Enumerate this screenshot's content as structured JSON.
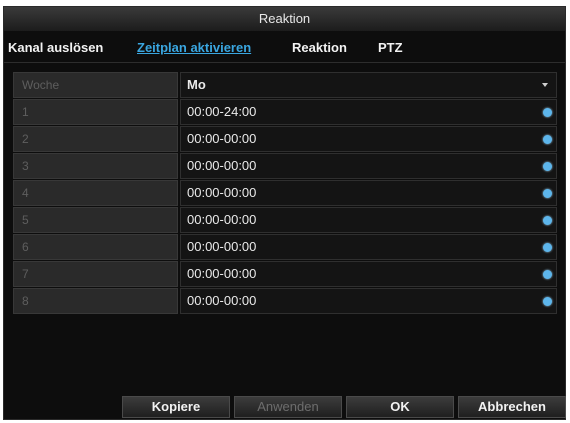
{
  "window": {
    "title": "Reaktion"
  },
  "tabs": [
    {
      "label": "Kanal auslösen",
      "active": false
    },
    {
      "label": "Zeitplan aktivieren",
      "active": true
    },
    {
      "label": "Reaktion",
      "active": false
    },
    {
      "label": "PTZ",
      "active": false
    }
  ],
  "schedule": {
    "day_label": "Woche",
    "day_value": "Mo",
    "rows": [
      {
        "index": "1",
        "time": "00:00-24:00"
      },
      {
        "index": "2",
        "time": "00:00-00:00"
      },
      {
        "index": "3",
        "time": "00:00-00:00"
      },
      {
        "index": "4",
        "time": "00:00-00:00"
      },
      {
        "index": "5",
        "time": "00:00-00:00"
      },
      {
        "index": "6",
        "time": "00:00-00:00"
      },
      {
        "index": "7",
        "time": "00:00-00:00"
      },
      {
        "index": "8",
        "time": "00:00-00:00"
      }
    ]
  },
  "buttons": {
    "copy": "Kopiere",
    "apply": "Anwenden",
    "ok": "OK",
    "cancel": "Abbrechen"
  },
  "colors": {
    "accent": "#3aa6e0",
    "edit_dot": "#5db6ec",
    "background": "#0d0d0d"
  }
}
